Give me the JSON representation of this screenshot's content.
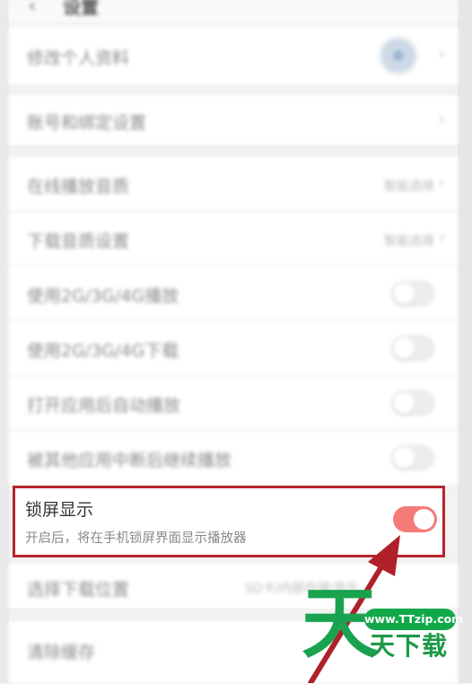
{
  "header": {
    "back_icon": "chevron-left",
    "title": "设置"
  },
  "rows": [
    {
      "label": "修改个人资料"
    },
    {
      "label": "账号和绑定设置"
    },
    {
      "label": "在线播放音质",
      "value": "智能选择"
    },
    {
      "label": "下载音质设置",
      "value": "智能选择"
    },
    {
      "label": "使用2G/3G/4G播放"
    },
    {
      "label": "使用2G/3G/4G下载"
    },
    {
      "label": "打开应用后自动播放"
    },
    {
      "label": "被其他应用中断后继续播放"
    }
  ],
  "highlight": {
    "title": "锁屏显示",
    "description": "开启后，将在手机锁屏界面显示播放器",
    "toggle_on": true
  },
  "bottom_rows": [
    {
      "label": "选择下载位置",
      "value": "SD卡/内部存储/音乐"
    },
    {
      "label": "清除缓存"
    }
  ],
  "watermark": {
    "badge": "www.TTzip.com",
    "big_char": "天",
    "small_text": "天下载"
  },
  "colors": {
    "toggle_on": "#f47b78",
    "highlight_border": "#b8242c",
    "arrow": "#b0202a",
    "logo_green": "#1aa34f"
  }
}
